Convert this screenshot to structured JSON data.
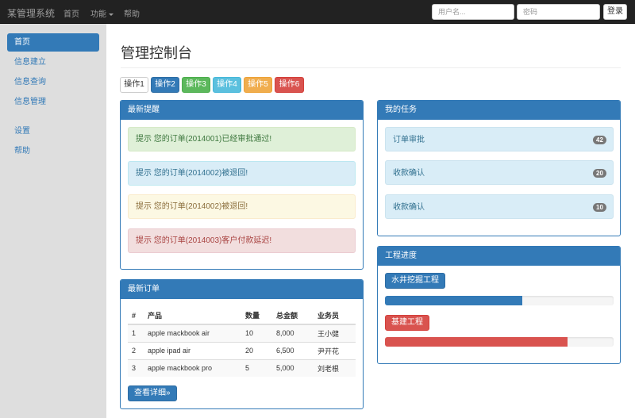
{
  "navbar": {
    "brand": "某管理系统",
    "links": [
      "首页",
      "功能",
      "帮助"
    ],
    "username_placeholder": "用户名...",
    "password_placeholder": "密码",
    "login_label": "登录"
  },
  "sidebar": {
    "items": [
      "首页",
      "信息建立",
      "信息查询",
      "信息管理",
      "设置",
      "帮助"
    ],
    "active_index": 0
  },
  "main": {
    "title": "管理控制台",
    "op_buttons": [
      {
        "label": "操作1",
        "style": "default"
      },
      {
        "label": "操作2",
        "style": "primary"
      },
      {
        "label": "操作3",
        "style": "success"
      },
      {
        "label": "操作4",
        "style": "info"
      },
      {
        "label": "操作5",
        "style": "warning"
      },
      {
        "label": "操作6",
        "style": "danger"
      }
    ]
  },
  "alerts_panel": {
    "title": "最新提醒",
    "alerts": [
      {
        "text": "提示 您的订单(2014001)已经审批通过!",
        "type": "success"
      },
      {
        "text": "提示 您的订单(2014002)被退回!",
        "type": "info"
      },
      {
        "text": "提示 您的订单(2014002)被退回!",
        "type": "warning"
      },
      {
        "text": "提示 您的订单(2014003)客户付款延迟!",
        "type": "danger"
      }
    ]
  },
  "tasks_panel": {
    "title": "我的任务",
    "tasks": [
      {
        "label": "订单审批",
        "count": "42"
      },
      {
        "label": "收款确认",
        "count": "20"
      },
      {
        "label": "收款确认",
        "count": "10"
      }
    ]
  },
  "orders_panel": {
    "title": "最新订单",
    "columns": [
      "#",
      "产品",
      "数量",
      "总金额",
      "业务员"
    ],
    "rows": [
      [
        "1",
        "apple mackbook air",
        "10",
        "8,000",
        "王小健"
      ],
      [
        "2",
        "apple ipad air",
        "20",
        "6,500",
        "尹开花"
      ],
      [
        "3",
        "apple mackbook pro",
        "5",
        "5,000",
        "刘老根"
      ]
    ],
    "details_label": "查看详细»"
  },
  "progress_panel": {
    "title": "工程进度",
    "projects": [
      {
        "label": "水井挖掘工程",
        "progress": 0.6,
        "color": "#337ab7"
      },
      {
        "label": "基建工程",
        "progress": 0.8,
        "color": "#d9534f"
      }
    ]
  },
  "colors": {
    "primary": "#337ab7",
    "success": "#5cb85c",
    "info": "#5bc0de",
    "warning": "#f0ad4e",
    "danger": "#d9534f",
    "navbar": "#222222",
    "sidebar": "#dedede"
  }
}
